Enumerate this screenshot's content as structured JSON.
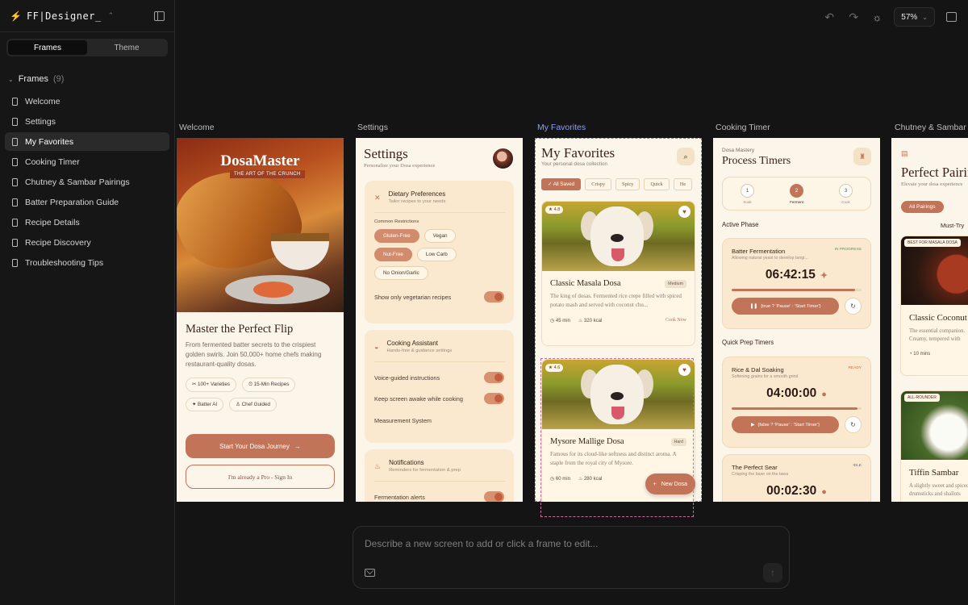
{
  "sidebar": {
    "logo_text": "FF|Designer_",
    "tabs": [
      {
        "label": "Frames"
      },
      {
        "label": "Theme"
      }
    ],
    "frames_heading": "Frames",
    "frames_count": "(9)",
    "frames": [
      {
        "label": "Welcome"
      },
      {
        "label": "Settings"
      },
      {
        "label": "My Favorites"
      },
      {
        "label": "Cooking Timer"
      },
      {
        "label": "Chutney & Sambar Pairings"
      },
      {
        "label": "Batter Preparation Guide"
      },
      {
        "label": "Recipe Details"
      },
      {
        "label": "Recipe Discovery"
      },
      {
        "label": "Troubleshooting Tips"
      }
    ]
  },
  "toolbar": {
    "zoom": "57%"
  },
  "canvas": {
    "frame_labels": [
      "Welcome",
      "Settings",
      "My Favorites",
      "Cooking Timer",
      "Chutney & Sambar"
    ]
  },
  "welcome": {
    "brand": "DosaMaster",
    "tagline": "THE ART OF THE CRUNCH",
    "title": "Master the Perfect Flip",
    "desc": "From fermented batter secrets to the crispiest golden swirls. Join 50,000+ home chefs making restaurant-quality dosas.",
    "chips": [
      "100+ Varieties",
      "15-Min Recipes",
      "Batter AI",
      "Chef Guided"
    ],
    "primary": "Start Your Dosa Journey",
    "secondary": "I'm already a Pro - Sign In"
  },
  "settings": {
    "title": "Settings",
    "subtitle": "Personalize your Dosa experience",
    "dietary": {
      "title": "Dietary Preferences",
      "sub": "Tailor recipes to your needs",
      "label": "Common Restrictions",
      "tags": [
        "Gluten-Free",
        "Vegan",
        "Nut-Free",
        "Low Carb",
        "No Onion/Garlic"
      ],
      "veg_only": "Show only vegetarian recipes"
    },
    "assistant": {
      "title": "Cooking Assistant",
      "sub": "Hands-free & guidance settings",
      "voice": "Voice-guided instructions",
      "awake": "Keep screen awake while cooking",
      "measure": "Measurement System"
    },
    "notifications": {
      "title": "Notifications",
      "sub": "Reminders for fermentation & prep",
      "alerts": "Fermentation alerts"
    }
  },
  "favorites": {
    "title": "My Favorites",
    "subtitle": "Your personal dosa collection",
    "filters": [
      "All Saved",
      "Crispy",
      "Spicy",
      "Quick",
      "He"
    ],
    "cards": [
      {
        "rating": "4.8",
        "title": "Classic Masala Dosa",
        "badge": "Medium",
        "desc": "The king of dosas. Fermented rice crepe filled with spiced potato mash and served with coconut chu...",
        "time": "45 min",
        "kcal": "320 kcal",
        "cta": "Cook Now"
      },
      {
        "rating": "4.6",
        "title": "Mysore Mallige Dosa",
        "badge": "Hard",
        "desc": "Famous for its cloud-like softness and distinct aroma. A staple from the royal city of Mysore.",
        "time": "60 min",
        "kcal": "280 kcal",
        "cta": ""
      }
    ],
    "fab": "New Dosa"
  },
  "timer": {
    "brand": "Dosa Mastery",
    "title": "Process Timers",
    "steps": [
      {
        "n": "1",
        "label": "Soak"
      },
      {
        "n": "2",
        "label": "Ferment"
      },
      {
        "n": "3",
        "label": "Cook"
      }
    ],
    "active_label": "Active Phase",
    "quick_label": "Quick Prep Timers",
    "timers": [
      {
        "title": "Batter Fermentation",
        "status": "IN PROGRESS",
        "sub": "Allowing natural yeast to develop tangi...",
        "time": "06:42:15",
        "btn": "{true ? 'Pause' : 'Start Timer'}",
        "progress": 0.95
      },
      {
        "title": "Rice & Dal Soaking",
        "status": "READY",
        "sub": "Softening grains for a smooth grind",
        "time": "04:00:00",
        "btn": "{false ? 'Pause' : 'Start Timer'}",
        "progress": 0.97
      },
      {
        "title": "The Perfect Sear",
        "status": "IDLE",
        "sub": "Crisping the base on the tawa",
        "time": "00:02:30",
        "btn": "",
        "progress": 0
      }
    ],
    "status_colors": {
      "IN PROGRESS": "#4a9a4a",
      "READY": "#d46a3a",
      "IDLE": "#4a6ad0"
    }
  },
  "chutney": {
    "title": "Perfect Pairings",
    "subtitle": "Elevate your dosa experience",
    "pill": "All Pairings",
    "must": "Must-Try",
    "cards": [
      {
        "badge": "BEST FOR MASALA DOSA",
        "title": "Classic Coconut",
        "desc": "The essential companion. Creamy, tempered with",
        "meta": "10 mins"
      },
      {
        "badge": "ALL-ROUNDER",
        "title": "Tiffin Sambar",
        "desc": "A slightly sweet and spiced drumsticks and shallots",
        "meta": ""
      }
    ]
  },
  "prompt": {
    "placeholder": "Describe a new screen to add or click a frame to edit..."
  },
  "colors": {
    "accent": "#c27459",
    "selection": "#6f86d8"
  }
}
